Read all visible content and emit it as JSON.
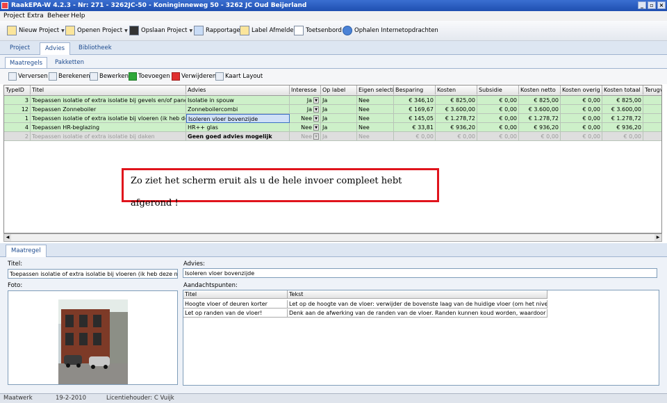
{
  "window": {
    "title": "RaakEPA-W 4.2.3 - Nr: 271 - 3262JC-50 - Koninginneweg 50 - 3262 JC Oud Beijerland"
  },
  "menu": [
    "Project",
    "Extra",
    "Beheer",
    "Help"
  ],
  "toolbar": {
    "new_project": "Nieuw Project",
    "open_project": "Openen Project",
    "save_project": "Opslaan Project",
    "report": "Rapportage",
    "label_signoff": "Label Afmelden",
    "keyboard": "Toetsenbord",
    "fetch": "Ophalen Internetopdrachten"
  },
  "main_tabs": [
    "Project",
    "Advies",
    "Bibliotheek"
  ],
  "sub_tabs": [
    "Maatregels",
    "Pakketten"
  ],
  "actions": {
    "refresh": "Verversen",
    "calculate": "Berekenen",
    "edit": "Bewerken",
    "add": "Toevoegen",
    "delete": "Verwijderen",
    "layout": "Kaart Layout"
  },
  "grid": {
    "columns": [
      "TypeID",
      "Titel",
      "Advies",
      "Interesse",
      "Op label",
      "Eigen selectie",
      "Besparing",
      "Kosten",
      "Subsidie",
      "Kosten netto",
      "Kosten overig",
      "Kosten totaal",
      "Terugv"
    ],
    "rows": [
      {
        "id": "3",
        "titel": "Toepassen isolatie of extra isolatie bij gevels en/of panelen",
        "advies": "Isolatie in spouw",
        "interesse": "Ja",
        "oplabel": "Ja",
        "eigen": "Nee",
        "besparing": "€ 346,10",
        "kosten": "€ 825,00",
        "subsidie": "€ 0,00",
        "netto": "€ 825,00",
        "overig": "€ 0,00",
        "totaal": "€ 825,00"
      },
      {
        "id": "12",
        "titel": "Toepassen Zonneboiler",
        "advies": "Zonneboilercombi",
        "interesse": "Ja",
        "oplabel": "Ja",
        "eigen": "Nee",
        "besparing": "€ 169,67",
        "kosten": "€ 3.600,00",
        "subsidie": "€ 0,00",
        "netto": "€ 3.600,00",
        "overig": "€ 0,00",
        "totaal": "€ 3.600,00"
      },
      {
        "id": "1",
        "titel": "Toepassen isolatie of extra isolatie bij vloeren (ik heb deze na",
        "advies": "Isoleren vloer bovenzijde",
        "interesse": "Nee",
        "oplabel": "Ja",
        "eigen": "Nee",
        "besparing": "€ 145,05",
        "kosten": "€ 1.278,72",
        "subsidie": "€ 0,00",
        "netto": "€ 1.278,72",
        "overig": "€ 0,00",
        "totaal": "€ 1.278,72"
      },
      {
        "id": "4",
        "titel": "Toepassen HR-beglazing",
        "advies": "HR++ glas",
        "interesse": "Nee",
        "oplabel": "Ja",
        "eigen": "Nee",
        "besparing": "€ 33,81",
        "kosten": "€ 936,20",
        "subsidie": "€ 0,00",
        "netto": "€ 936,20",
        "overig": "€ 0,00",
        "totaal": "€ 936,20"
      },
      {
        "id": "2",
        "titel": "Toepassen isolatie of extra isolatie bij daken",
        "advies": "Geen goed advies mogelijk",
        "interesse": "Nee",
        "oplabel": "Ja",
        "eigen": "Nee",
        "besparing": "€ 0,00",
        "kosten": "€ 0,00",
        "subsidie": "€ 0,00",
        "netto": "€ 0,00",
        "overig": "€ 0,00",
        "totaal": "€ 0,00"
      }
    ]
  },
  "notice": "Zo ziet het scherm eruit als u de hele invoer compleet hebt afgerond !",
  "detail_tab": "Maatregel",
  "detail": {
    "titel_label": "Titel:",
    "titel_value": "Toepassen isolatie of extra isolatie bij vloeren (ik heb deze naam ge",
    "advies_label": "Advies:",
    "advies_value": "Isoleren vloer bovenzijde",
    "foto_label": "Foto:",
    "aandacht_label": "Aandachtspunten:",
    "aandacht_cols": [
      "Titel",
      "Tekst"
    ],
    "aandacht_rows": [
      {
        "titel": "Hoogte vloer of deuren korter",
        "tekst": "Let op de hoogte van de vloer: verwijder de bovenste laag van de huidige vloer (om het niveau van de"
      },
      {
        "titel": "Let op randen van de vloer!",
        "tekst": "Denk aan de afwerking van de randen van de vloer. Randen kunnen koud worden, waardoor schimmel"
      }
    ]
  },
  "status": {
    "left": "Maatwerk",
    "date": "19-2-2010",
    "license": "Licentiehouder: C Vuijk"
  }
}
